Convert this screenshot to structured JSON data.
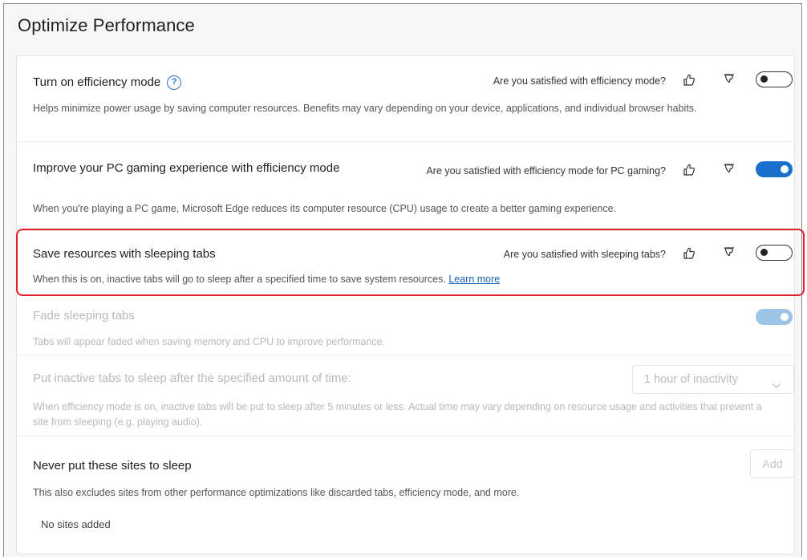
{
  "header": {
    "title": "Optimize Performance"
  },
  "efficiency": {
    "title": "Turn on efficiency mode",
    "question": "Are you satisfied with efficiency mode?",
    "description": "Helps minimize power usage by saving computer resources. Benefits may vary depending on your device, applications, and individual browser habits.",
    "toggle": "off"
  },
  "gaming": {
    "title": "Improve your PC gaming experience with efficiency mode",
    "question": "Are you satisfied with efficiency mode for PC gaming?",
    "description": "When you're playing a PC game, Microsoft Edge reduces its computer resource (CPU) usage to create a better gaming experience.",
    "toggle": "on"
  },
  "sleeping": {
    "title": "Save resources with sleeping tabs",
    "question": "Are you satisfied with sleeping tabs?",
    "description": "When this is on, inactive tabs will go to sleep after a specified time to save system resources.",
    "learn_more": "Learn more",
    "toggle": "off"
  },
  "fade": {
    "title": "Fade sleeping tabs",
    "description": "Tabs will appear faded when saving memory and CPU to improve performance.",
    "toggle": "on-disabled"
  },
  "inactive": {
    "title": "Put inactive tabs to sleep after the specified amount of time:",
    "description": "When efficiency mode is on, inactive tabs will be put to sleep after 5 minutes or less. Actual time may vary depending on resource usage and activities that prevent a site from sleeping (e.g. playing audio).",
    "selected": "1 hour of inactivity"
  },
  "never_sleep": {
    "title": "Never put these sites to sleep",
    "description": "This also excludes sites from other performance optimizations like discarded tabs, efficiency mode, and more.",
    "add_label": "Add",
    "empty_text": "No sites added"
  },
  "icons": {
    "help": "help-circle-icon",
    "like": "thumbs-up-icon",
    "dislike": "thumbs-down-icon",
    "chevron": "chevron-down-icon"
  },
  "colors": {
    "accent": "#1a6ecc",
    "highlight": "#e0202a",
    "link": "#1a5fb4"
  }
}
